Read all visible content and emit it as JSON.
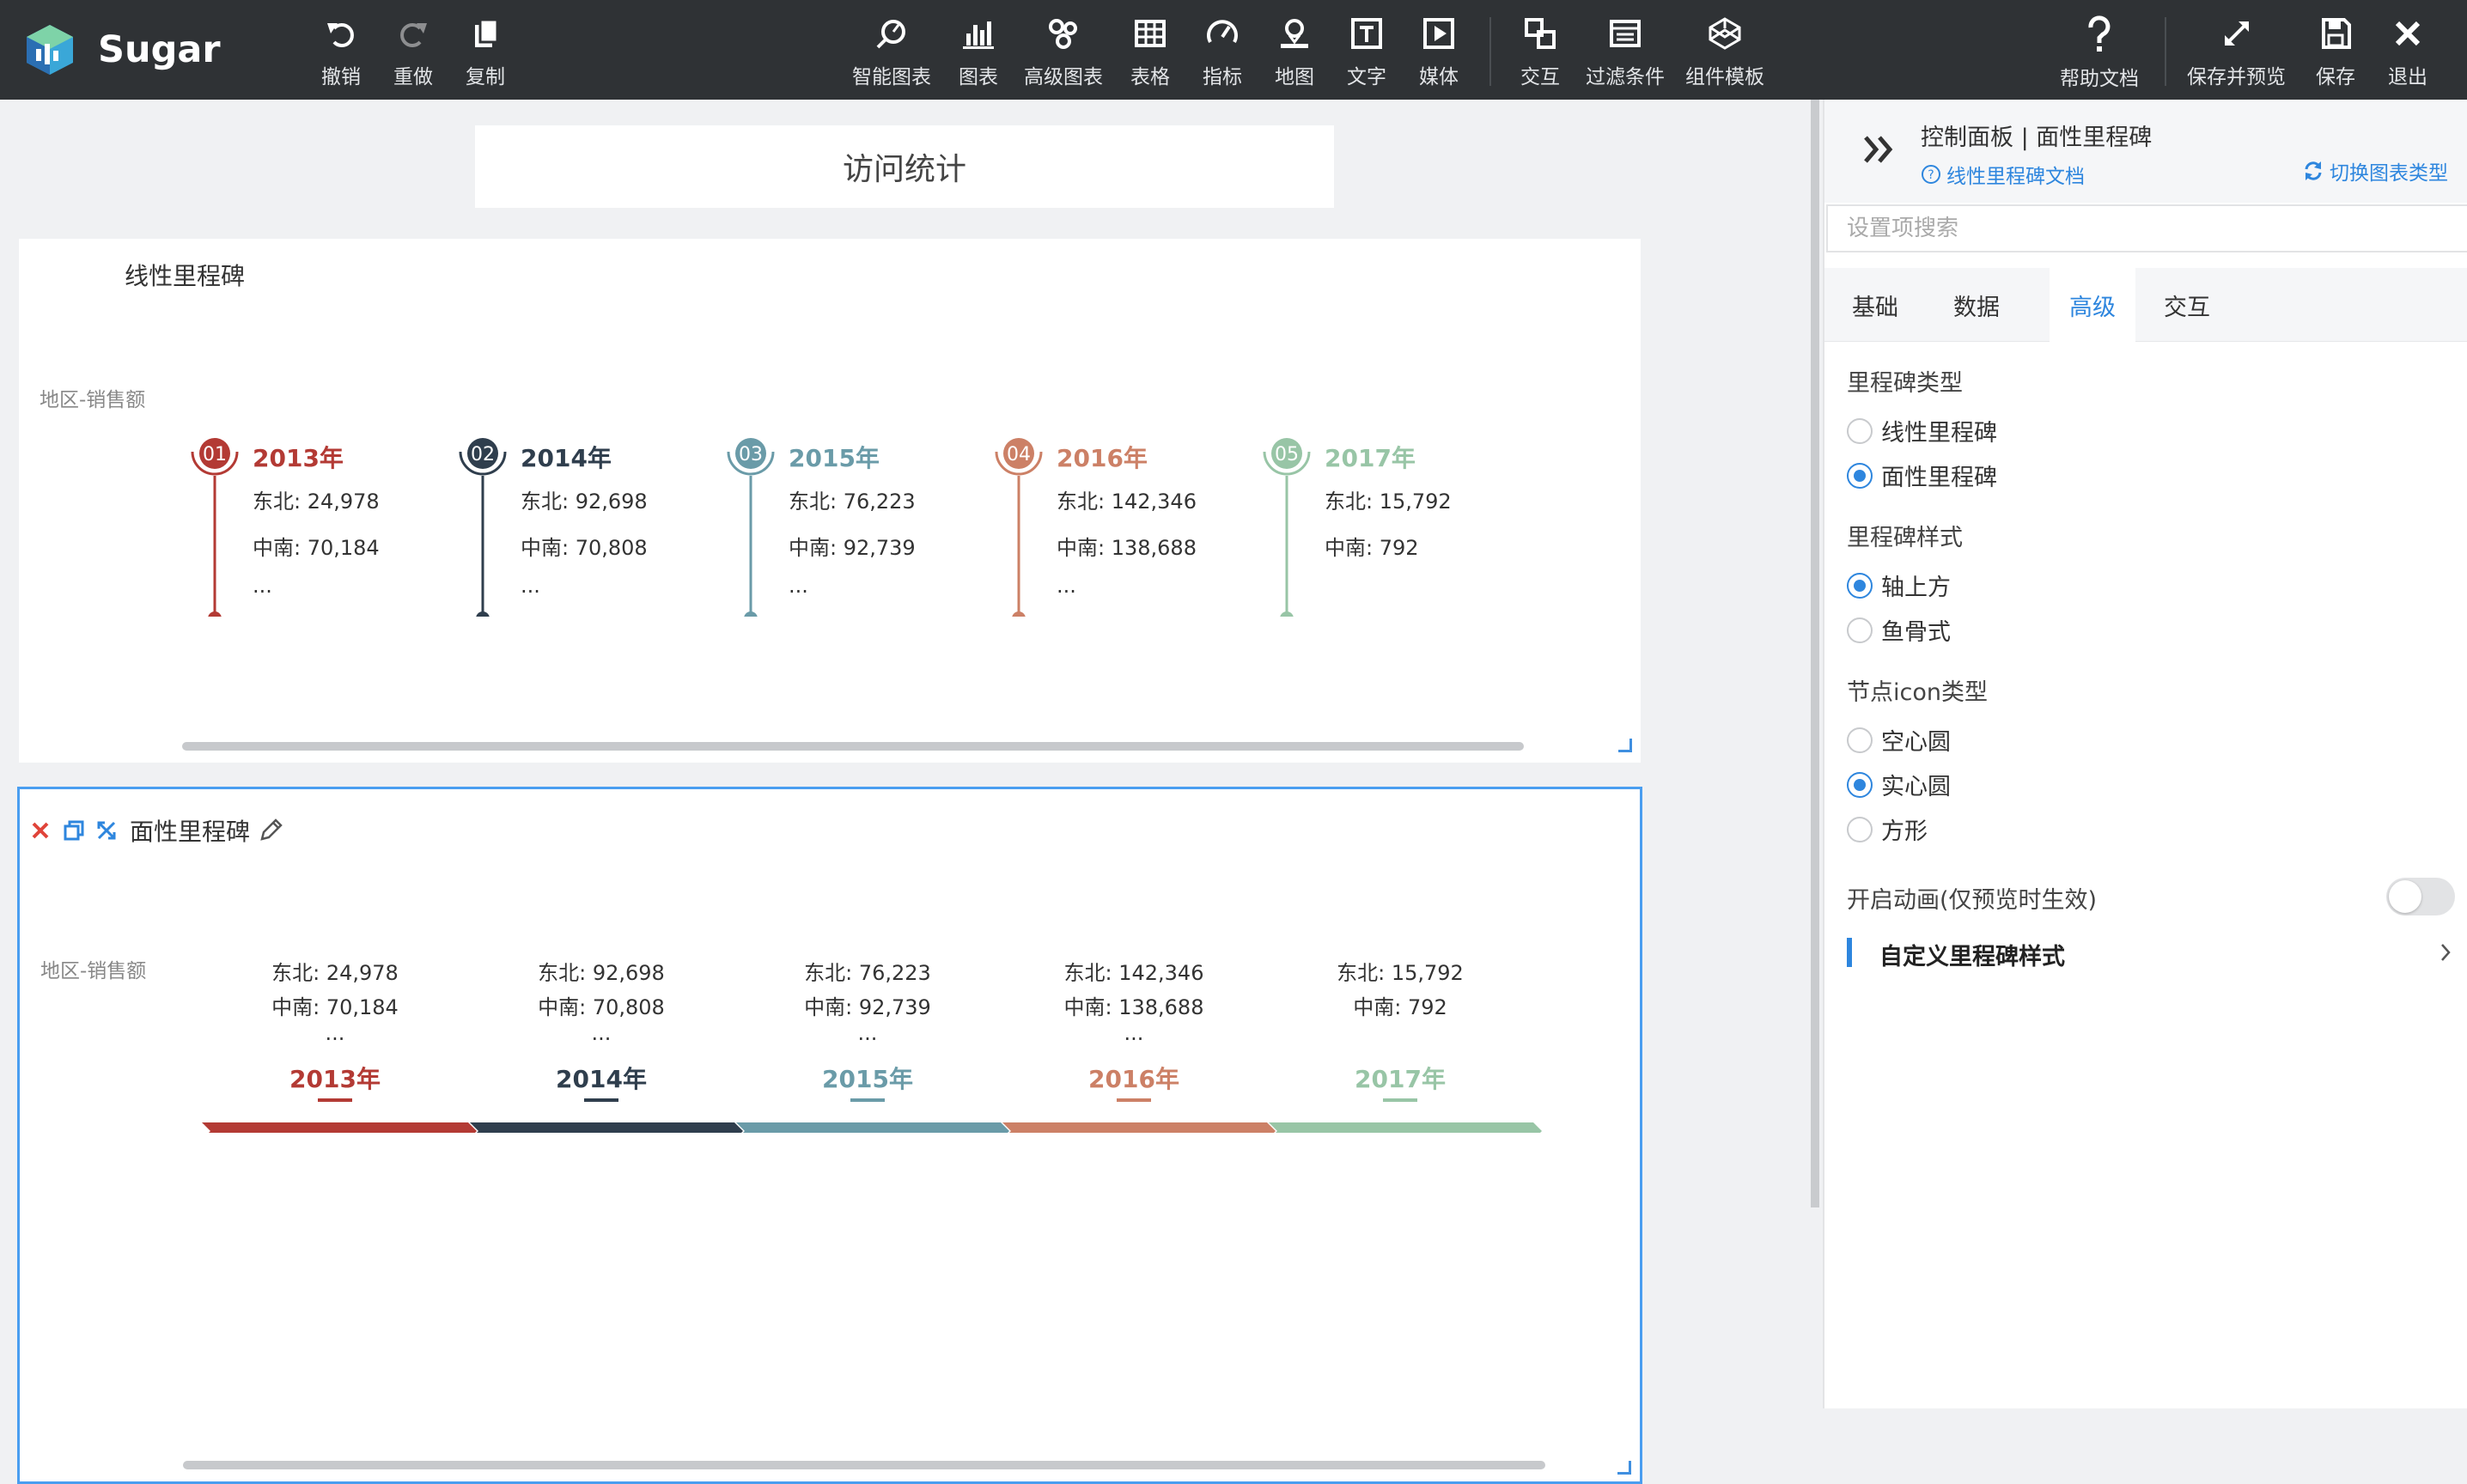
{
  "app": {
    "name": "Sugar"
  },
  "toolbar": {
    "undo": "撤销",
    "redo": "重做",
    "copy": "复制",
    "smart_chart": "智能图表",
    "chart": "图表",
    "advanced_chart": "高级图表",
    "table": "表格",
    "indicator": "指标",
    "map": "地图",
    "text": "文字",
    "media": "媒体",
    "interaction": "交互",
    "filter": "过滤条件",
    "component_template": "组件模板",
    "help": "帮助文档",
    "save_preview": "保存并预览",
    "save": "保存",
    "exit": "退出"
  },
  "canvas": {
    "page_title": "访问统计",
    "panel1": {
      "title": "线性里程碑",
      "row_label": "地区-销售额"
    },
    "panel2": {
      "title": "面性里程碑",
      "row_label": "地区-销售额"
    }
  },
  "milestones": [
    {
      "index": "01",
      "year": "2013年",
      "line1": "东北: 24,978",
      "line2": "中南: 70,184",
      "more": "...",
      "color": "#b33a34"
    },
    {
      "index": "02",
      "year": "2014年",
      "line1": "东北: 92,698",
      "line2": "中南: 70,808",
      "more": "...",
      "color": "#2f3e4d"
    },
    {
      "index": "03",
      "year": "2015年",
      "line1": "东北: 76,223",
      "line2": "中南: 92,739",
      "more": "...",
      "color": "#6a9ba8"
    },
    {
      "index": "04",
      "year": "2016年",
      "line1": "东北: 142,346",
      "line2": "中南: 138,688",
      "more": "...",
      "color": "#cc8066"
    },
    {
      "index": "05",
      "year": "2017年",
      "line1": "东北: 15,792",
      "line2": "中南: 792",
      "more": "",
      "color": "#98c5a6"
    }
  ],
  "control_panel": {
    "title": "控制面板 | 面性里程碑",
    "doc_link": "线性里程碑文档",
    "switch_type": "切换图表类型",
    "search_placeholder": "设置项搜索",
    "tabs": [
      "基础",
      "数据",
      "高级",
      "交互"
    ],
    "active_tab": "高级",
    "milestone_type": {
      "label": "里程碑类型",
      "options": [
        "线性里程碑",
        "面性里程碑"
      ],
      "selected": "面性里程碑"
    },
    "milestone_style": {
      "label": "里程碑样式",
      "options": [
        "轴上方",
        "鱼骨式"
      ],
      "selected": "轴上方"
    },
    "node_icon_type": {
      "label": "节点icon类型",
      "options": [
        "空心圆",
        "实心圆",
        "方形"
      ],
      "selected": "实心圆"
    },
    "animation": {
      "label": "开启动画(仅预览时生效)",
      "enabled": false
    },
    "custom_style": "自定义里程碑样式"
  },
  "colors": {
    "accent": "#2e86de",
    "topbar": "#2f3235",
    "selection_border": "#4a9ef0"
  }
}
